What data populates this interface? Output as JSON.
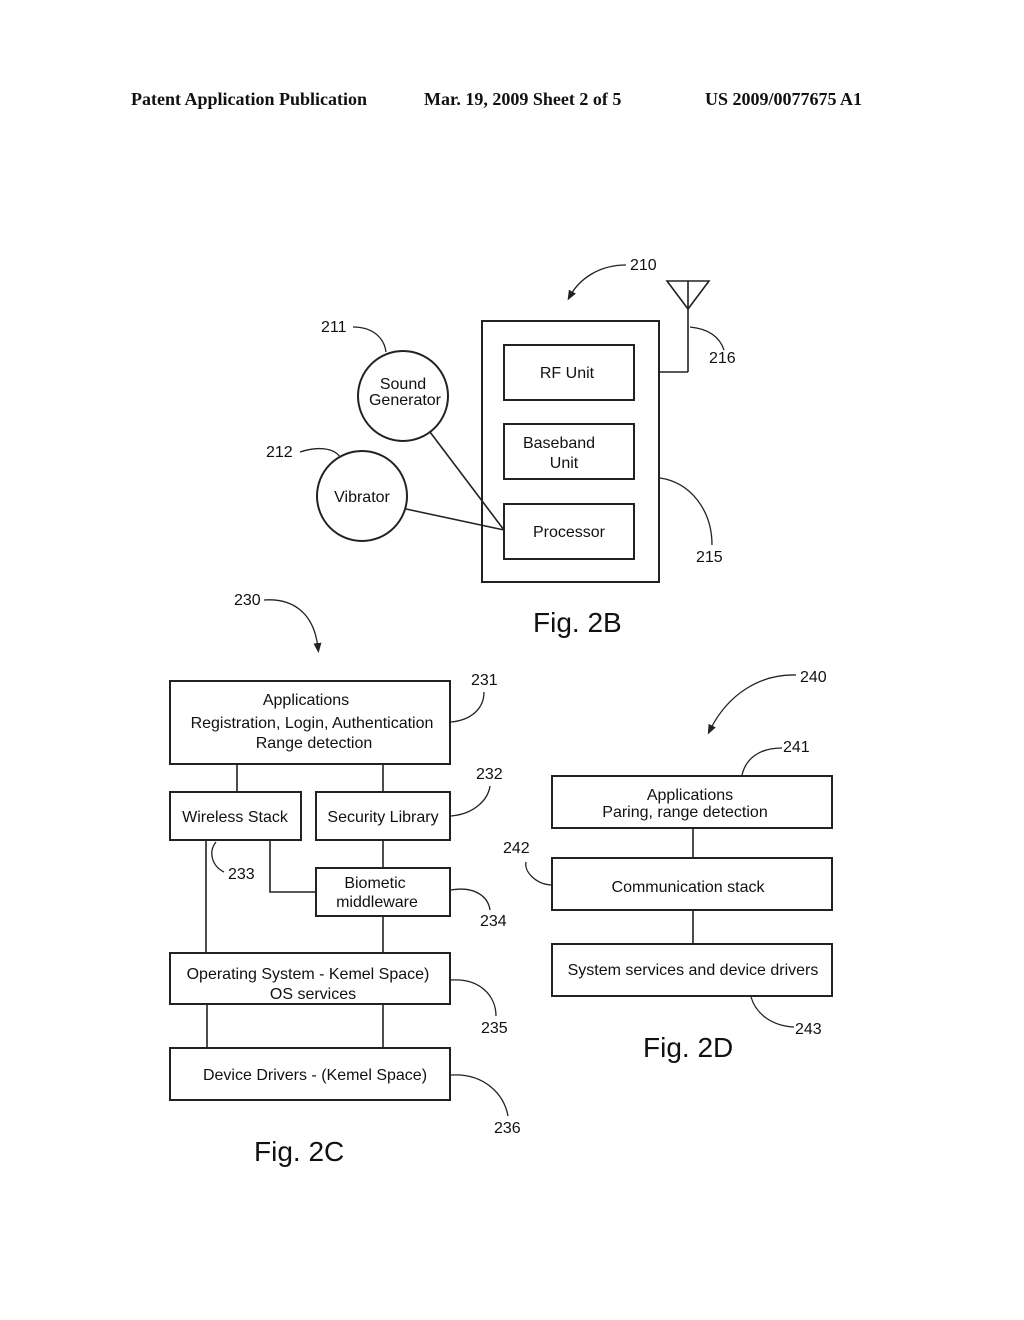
{
  "header": {
    "left": "Patent Application Publication",
    "center": "Mar. 19, 2009  Sheet 2 of 5",
    "right": "US 2009/0077675 A1"
  },
  "fig2b": {
    "caption": "Fig.  2B",
    "ref_device": "210",
    "ref_sound": "211",
    "ref_vibrator": "212",
    "ref_housing": "215",
    "ref_antenna": "216",
    "sound_line1": "Sound",
    "sound_line2": "Generator",
    "vibrator": "Vibrator",
    "rf_unit": "RF Unit",
    "baseband_line1": "Baseband",
    "baseband_line2": "Unit",
    "processor": "Processor"
  },
  "fig2c": {
    "caption": "Fig.  2C",
    "ref_stack": "230",
    "ref_apps": "231",
    "ref_security": "232",
    "ref_wireless": "233",
    "ref_biometric": "234",
    "ref_os": "235",
    "ref_drivers": "236",
    "apps_line1": "Applications",
    "apps_line2": "Registration, Login, Authentication",
    "apps_line3": "Range detection",
    "wireless": "Wireless Stack",
    "security": "Security Library",
    "biometric_line1": "Biometic",
    "biometric_line2": "middleware",
    "os_line1": "Operating System - Kemel Space)",
    "os_line2": "OS services",
    "drivers": "Device Drivers - (Kemel Space)"
  },
  "fig2d": {
    "caption": "Fig.  2D",
    "ref_stack": "240",
    "ref_apps": "241",
    "ref_comm": "242",
    "ref_sys": "243",
    "apps_line1": "Applications",
    "apps_line2": "Paring, range detection",
    "comm": "Communication stack",
    "sys": "System services and device drivers"
  }
}
